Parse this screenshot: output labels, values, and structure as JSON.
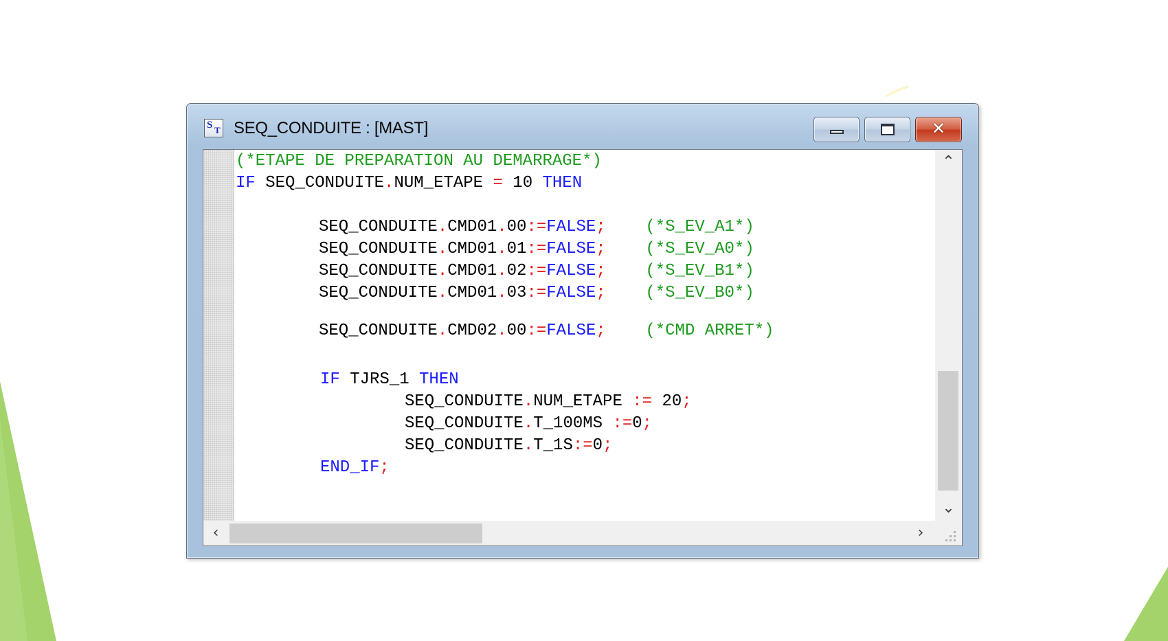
{
  "window": {
    "title": "SEQ_CONDUITE : [MAST]",
    "app_icon": {
      "name": "st-editor-icon",
      "s": "S",
      "t": "T"
    },
    "buttons": {
      "minimize": "minimize-icon",
      "maximize": "maximize-icon",
      "close_glyph": "✕"
    }
  },
  "code_lines": [
    [
      {
        "t": "(*ETAPE DE PREPARATION AU DEMARRAGE*)",
        "c": "cmt"
      }
    ],
    [
      {
        "t": "IF",
        "c": "kw"
      },
      {
        "t": " SEQ_CONDUITE"
      },
      {
        "t": ".",
        "c": "op"
      },
      {
        "t": "NUM_ETAPE "
      },
      {
        "t": "=",
        "c": "op"
      },
      {
        "t": " 10 "
      },
      {
        "t": "THEN",
        "c": "kw"
      }
    ],
    [
      {
        "t": "SEQ_CONDUITE"
      },
      {
        "t": ".",
        "c": "op"
      },
      {
        "t": "CMD01"
      },
      {
        "t": ".",
        "c": "op"
      },
      {
        "t": "00"
      },
      {
        "t": ":=",
        "c": "op"
      },
      {
        "t": "FALSE",
        "c": "kw"
      },
      {
        "t": ";",
        "c": "op"
      },
      {
        "t": "    "
      },
      {
        "t": "(*S_EV_A1*)",
        "c": "cmt"
      }
    ],
    [
      {
        "t": "SEQ_CONDUITE"
      },
      {
        "t": ".",
        "c": "op"
      },
      {
        "t": "CMD01"
      },
      {
        "t": ".",
        "c": "op"
      },
      {
        "t": "01"
      },
      {
        "t": ":=",
        "c": "op"
      },
      {
        "t": "FALSE",
        "c": "kw"
      },
      {
        "t": ";",
        "c": "op"
      },
      {
        "t": "    "
      },
      {
        "t": "(*S_EV_A0*)",
        "c": "cmt"
      }
    ],
    [
      {
        "t": "SEQ_CONDUITE"
      },
      {
        "t": ".",
        "c": "op"
      },
      {
        "t": "CMD01"
      },
      {
        "t": ".",
        "c": "op"
      },
      {
        "t": "02"
      },
      {
        "t": ":=",
        "c": "op"
      },
      {
        "t": "FALSE",
        "c": "kw"
      },
      {
        "t": ";",
        "c": "op"
      },
      {
        "t": "    "
      },
      {
        "t": "(*S_EV_B1*)",
        "c": "cmt"
      }
    ],
    [
      {
        "t": "SEQ_CONDUITE"
      },
      {
        "t": ".",
        "c": "op"
      },
      {
        "t": "CMD01"
      },
      {
        "t": ".",
        "c": "op"
      },
      {
        "t": "03"
      },
      {
        "t": ":=",
        "c": "op"
      },
      {
        "t": "FALSE",
        "c": "kw"
      },
      {
        "t": ";",
        "c": "op"
      },
      {
        "t": "    "
      },
      {
        "t": "(*S_EV_B0*)",
        "c": "cmt"
      }
    ],
    [
      {
        "t": "SEQ_CONDUITE"
      },
      {
        "t": ".",
        "c": "op"
      },
      {
        "t": "CMD02"
      },
      {
        "t": ".",
        "c": "op"
      },
      {
        "t": "00"
      },
      {
        "t": ":=",
        "c": "op"
      },
      {
        "t": "FALSE",
        "c": "kw"
      },
      {
        "t": ";",
        "c": "op"
      },
      {
        "t": "    "
      },
      {
        "t": "(*CMD ARRET*)",
        "c": "cmt"
      }
    ],
    [
      {
        "t": "IF",
        "c": "kw"
      },
      {
        "t": " TJRS_1 "
      },
      {
        "t": "THEN",
        "c": "kw"
      }
    ],
    [
      {
        "t": "SEQ_CONDUITE"
      },
      {
        "t": ".",
        "c": "op"
      },
      {
        "t": "NUM_ETAPE "
      },
      {
        "t": ":=",
        "c": "op"
      },
      {
        "t": " 20"
      },
      {
        "t": ";",
        "c": "op"
      }
    ],
    [
      {
        "t": "SEQ_CONDUITE"
      },
      {
        "t": ".",
        "c": "op"
      },
      {
        "t": "T_100MS "
      },
      {
        "t": ":=",
        "c": "op"
      },
      {
        "t": "0"
      },
      {
        "t": ";",
        "c": "op"
      }
    ],
    [
      {
        "t": "SEQ_CONDUITE"
      },
      {
        "t": ".",
        "c": "op"
      },
      {
        "t": "T_1S"
      },
      {
        "t": ":=",
        "c": "op"
      },
      {
        "t": "0"
      },
      {
        "t": ";",
        "c": "op"
      }
    ],
    [
      {
        "t": "END_IF",
        "c": "kw"
      },
      {
        "t": ";",
        "c": "op"
      }
    ]
  ],
  "scrollbars": {
    "up_glyph": "⌃",
    "down_glyph": "⌄",
    "left_glyph": "‹",
    "right_glyph": "›"
  },
  "colors": {
    "comment": "#1d9b1d",
    "keyword": "#1a1aff",
    "operator": "#e31c1c",
    "decoration_green": "#a3d36a"
  }
}
